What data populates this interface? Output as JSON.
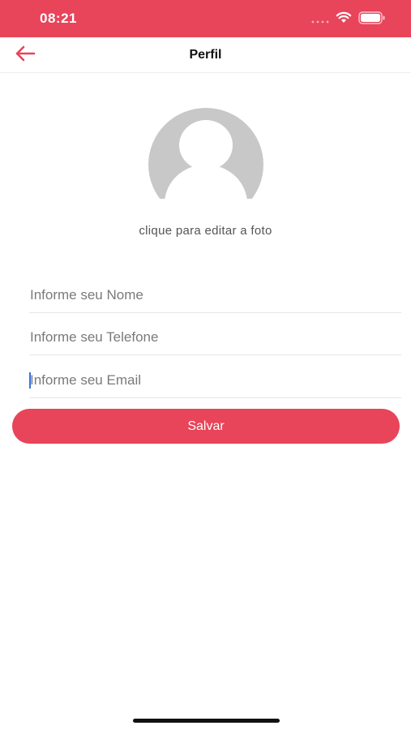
{
  "status_bar": {
    "time": "08:21",
    "background_color": "#e8445a",
    "icons": [
      "signal-icon",
      "wifi-icon",
      "battery-icon"
    ]
  },
  "header": {
    "title": "Perfil",
    "back_icon": "arrow-left-icon",
    "accent_color": "#e8445a"
  },
  "profile": {
    "avatar_icon": "default-avatar-icon",
    "edit_photo_label": "clique para editar a foto"
  },
  "form": {
    "name_placeholder": "Informe seu Nome",
    "phone_placeholder": "Informe seu Telefone",
    "email_placeholder": "Informe seu Email",
    "save_label": "Salvar",
    "button_color": "#e8445a"
  }
}
